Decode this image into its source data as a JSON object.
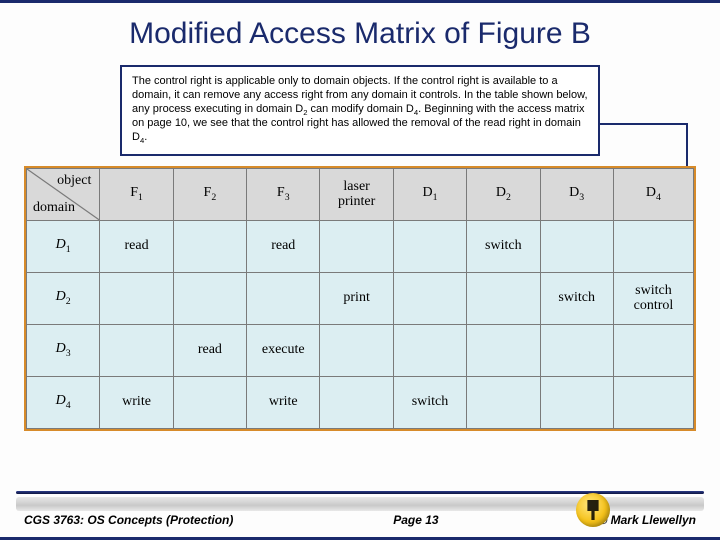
{
  "title": "Modified Access Matrix of Figure B",
  "note": {
    "p1": "The control right is applicable only to domain objects.  If the control right is available to a domain, it can remove any access right from any domain it controls.  In the table shown below, any process executing in domain D",
    "p1_sub": "2",
    "p2": " can modify domain D",
    "p2_sub": "4",
    "p3": ".  Beginning with the access matrix on page 10, we see that the control right has allowed the removal of the read right in domain D",
    "p3_sub": "4",
    "p4": "."
  },
  "corner": {
    "object": "object",
    "domain": "domain"
  },
  "cols": {
    "f1": "F",
    "f1s": "1",
    "f2": "F",
    "f2s": "2",
    "f3": "F",
    "f3s": "3",
    "lp1": "laser",
    "lp2": "printer",
    "d1": "D",
    "d1s": "1",
    "d2": "D",
    "d2s": "2",
    "d3": "D",
    "d3s": "3",
    "d4": "D",
    "d4s": "4"
  },
  "rows": {
    "r1": "D",
    "r1s": "1",
    "r2": "D",
    "r2s": "2",
    "r3": "D",
    "r3s": "3",
    "r4": "D",
    "r4s": "4"
  },
  "cells": {
    "d1_f1": "read",
    "d1_f3": "read",
    "d1_d2": "switch",
    "d2_lp": "print",
    "d2_d3": "switch",
    "d2_d4a": "switch",
    "d2_d4b": "control",
    "d3_f2": "read",
    "d3_f3": "execute",
    "d4_f1": "write",
    "d4_f3": "write",
    "d4_d1": "switch"
  },
  "footer": {
    "left": "CGS 3763: OS Concepts (Protection)",
    "mid": "Page 13",
    "right": "© Mark Llewellyn"
  }
}
